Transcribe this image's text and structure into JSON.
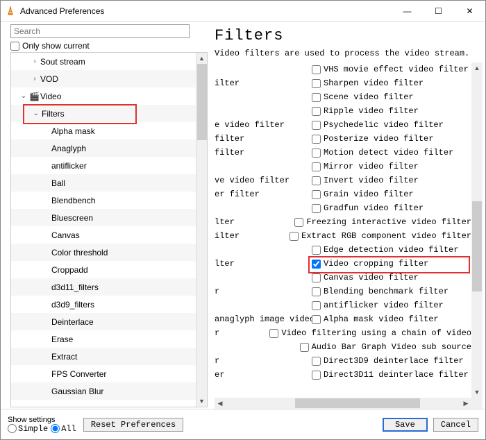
{
  "window": {
    "title": "Advanced Preferences"
  },
  "leftPane": {
    "search_placeholder": "Search",
    "only_show_current": "Only show current",
    "tree": {
      "sout": "Sout stream",
      "vod": "VOD",
      "video": "Video",
      "filters": "Filters",
      "items": [
        "Alpha mask",
        "Anaglyph",
        "antiflicker",
        "Ball",
        "Blendbench",
        "Bluescreen",
        "Canvas",
        "Color threshold",
        "Croppadd",
        "d3d11_filters",
        "d3d9_filters",
        "Deinterlace",
        "Erase",
        "Extract",
        "FPS Converter",
        "Gaussian Blur"
      ]
    }
  },
  "rightPane": {
    "heading": "Filters",
    "desc": "Video filters are used to process the video stream.",
    "rows": [
      {
        "left": "",
        "label": "VHS movie effect video filter",
        "checked": false
      },
      {
        "left": "ilter",
        "label": "Sharpen video filter",
        "checked": false
      },
      {
        "left": "",
        "label": "Scene video filter",
        "checked": false
      },
      {
        "left": "",
        "label": "Ripple video filter",
        "checked": false
      },
      {
        "left": "e video filter",
        "label": "Psychedelic video filter",
        "checked": false
      },
      {
        "left": "filter",
        "label": "Posterize video filter",
        "checked": false
      },
      {
        "left": " filter",
        "label": "Motion detect video filter",
        "checked": false
      },
      {
        "left": "",
        "label": "Mirror video filter",
        "checked": false
      },
      {
        "left": "ve video filter",
        "label": "Invert video filter",
        "checked": false
      },
      {
        "left": "er filter",
        "label": "Grain video filter",
        "checked": false
      },
      {
        "left": "",
        "label": "Gradfun video filter",
        "checked": false
      },
      {
        "left": "lter",
        "label": "Freezing interactive video filter",
        "checked": false
      },
      {
        "left": "ilter",
        "label": "Extract RGB component video filter",
        "checked": false
      },
      {
        "left": "",
        "label": "Edge detection video filter",
        "checked": false
      },
      {
        "left": "lter",
        "label": "Video cropping filter",
        "checked": true,
        "highlight": true
      },
      {
        "left": "",
        "label": "Canvas video filter",
        "checked": false
      },
      {
        "left": "r",
        "label": "Blending benchmark filter",
        "checked": false
      },
      {
        "left": "",
        "label": "antiflicker video filter",
        "checked": false
      },
      {
        "left": "anaglyph image video filter",
        "label": "Alpha mask video filter",
        "checked": false
      },
      {
        "left": "r",
        "label": "Video filtering using a chain of video",
        "checked": false
      },
      {
        "left": "",
        "label": "Audio Bar Graph Video sub source",
        "checked": false
      },
      {
        "left": "r",
        "label": "Direct3D9 deinterlace filter",
        "checked": false
      },
      {
        "left": "er",
        "label": "Direct3D11 deinterlace filter",
        "checked": false
      }
    ]
  },
  "footer": {
    "show_settings": "Show settings",
    "simple": "Simple",
    "all": "All",
    "reset": "Reset Preferences",
    "save": "Save",
    "cancel": "Cancel"
  }
}
